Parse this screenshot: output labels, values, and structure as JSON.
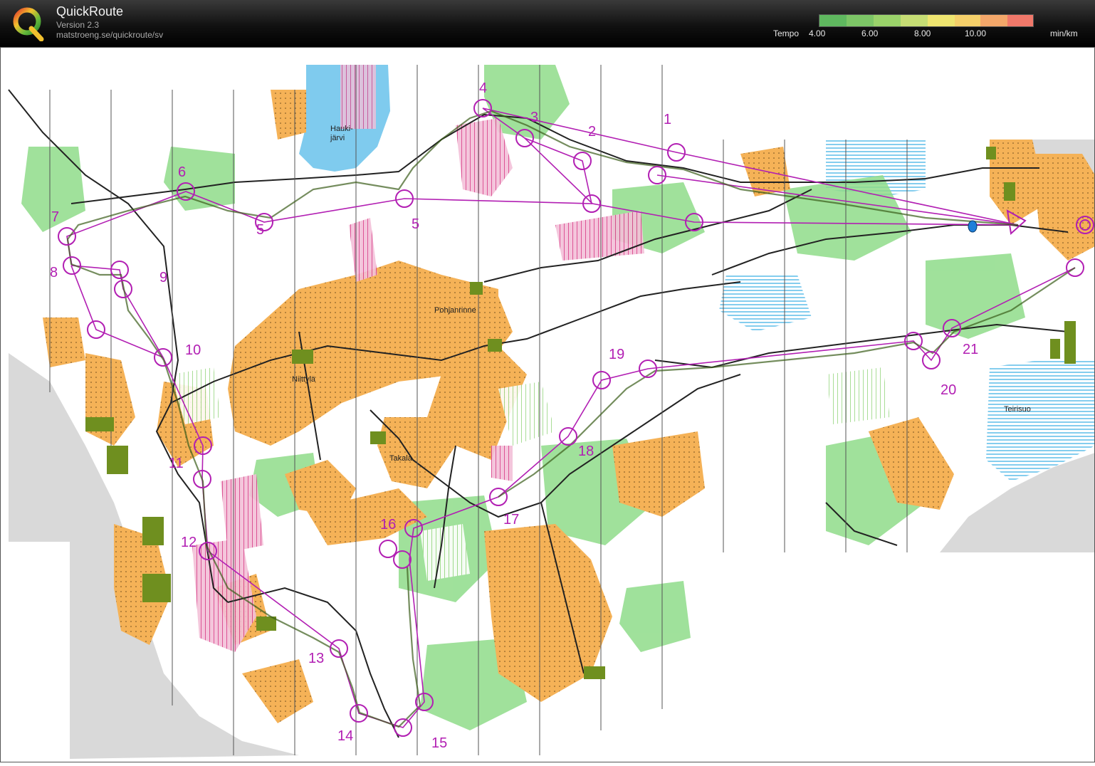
{
  "app": {
    "title": "QuickRoute",
    "version": "Version 2.3",
    "url": "matstroeng.se/quickroute/sv"
  },
  "legend": {
    "label": "Tempo",
    "ticks": [
      "4.00",
      "6.00",
      "8.00",
      "10.00"
    ],
    "unit": "min/km",
    "colors": [
      "#5fb85f",
      "#9ad26a",
      "#d8e37a",
      "#f2e06a",
      "#f3b26a",
      "#f07a6a"
    ]
  },
  "map": {
    "place_labels": {
      "haukijarvi_1": "Hauki-",
      "haukijarvi_2": "järvi",
      "pohjanrinne": "Pohjanrinne",
      "niittyla": "Niittylä",
      "takala": "Takala",
      "teirisuo": "Teirisuo"
    },
    "controls": [
      "1",
      "2",
      "3",
      "4",
      "5",
      "6",
      "7",
      "8",
      "9",
      "10",
      "11",
      "12",
      "13",
      "14",
      "15",
      "16",
      "17",
      "18",
      "19",
      "20",
      "21"
    ],
    "colors": {
      "course": "#b21fb3",
      "open_land": "#f5b257",
      "forest_green": "#8fdc8a",
      "marsh": "#4fb8e8",
      "water": "#7fcbee",
      "restricted": "#d9418a",
      "background_gray": "#d9d9d9"
    }
  }
}
